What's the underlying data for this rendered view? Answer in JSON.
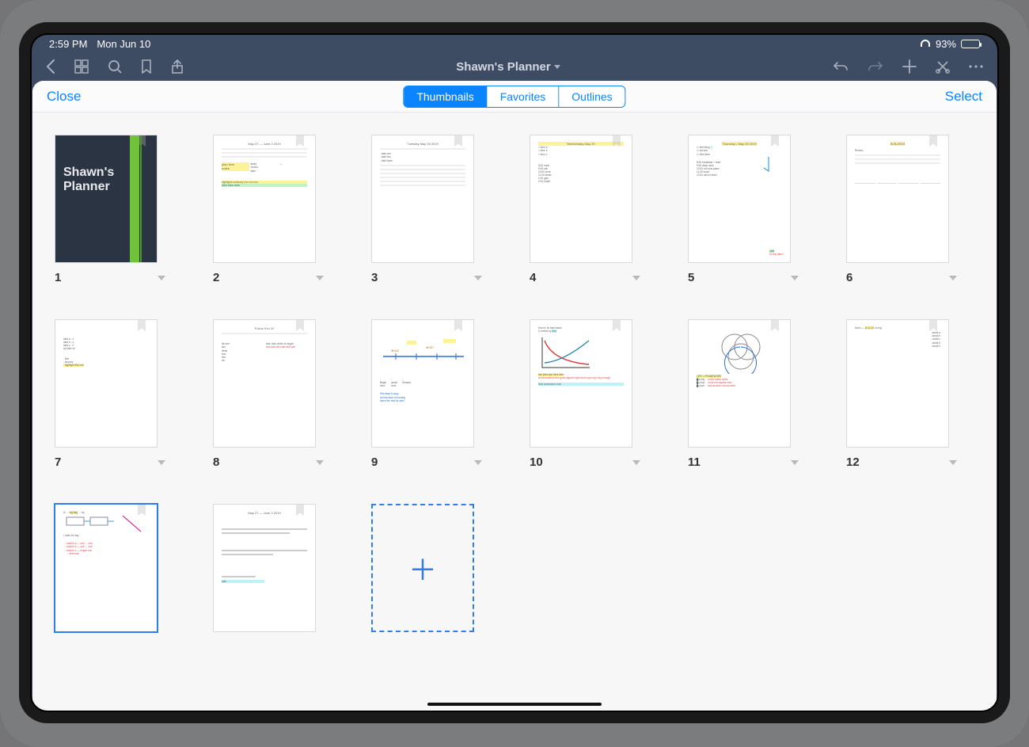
{
  "status": {
    "time": "2:59 PM",
    "date": "Mon Jun 10",
    "battery_pct": "93%"
  },
  "toolbar": {
    "title": "Shawn's Planner"
  },
  "panel": {
    "close": "Close",
    "select": "Select",
    "tabs": {
      "thumbnails": "Thumbnails",
      "favorites": "Favorites",
      "outlines": "Outlines"
    }
  },
  "cover": {
    "title_line1": "Shawn's",
    "title_line2": "Planner"
  },
  "pages": {
    "p1": "1",
    "p2": "2",
    "p3": "3",
    "p4": "4",
    "p5": "5",
    "p6": "6",
    "p7": "7",
    "p8": "8",
    "p9": "9",
    "p10": "10",
    "p11": "11",
    "p12": "12"
  }
}
